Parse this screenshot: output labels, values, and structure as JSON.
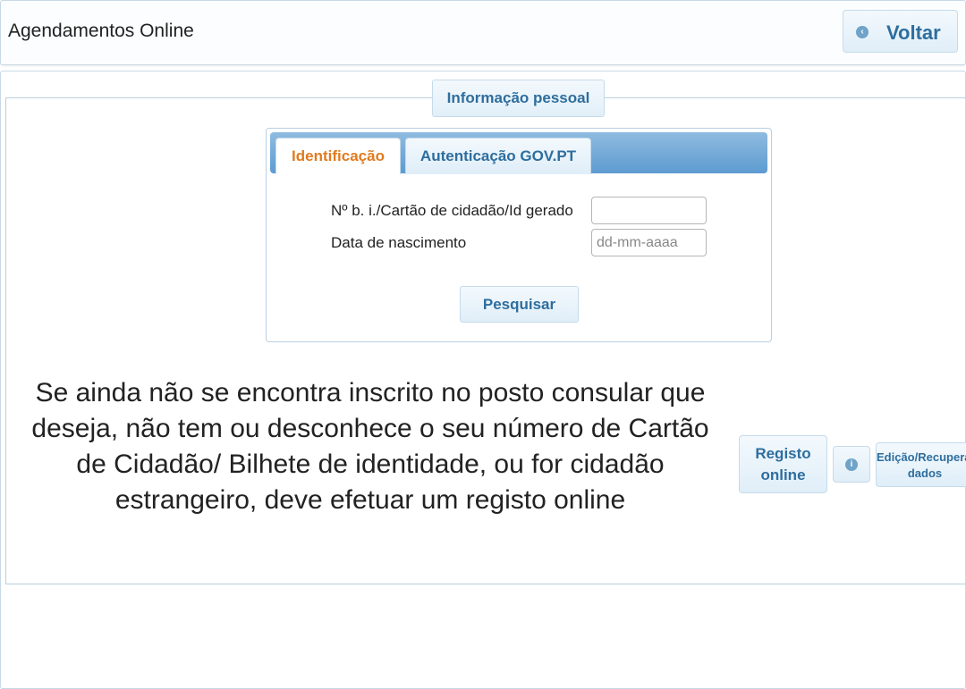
{
  "header": {
    "title": "Agendamentos Online",
    "back_label": "Voltar",
    "back_icon": "arrow-left-circle-icon"
  },
  "section": {
    "legend": "Informação pessoal"
  },
  "tabs": [
    {
      "label": "Identificação",
      "active": true
    },
    {
      "label": "Autenticação GOV.PT",
      "active": false
    }
  ],
  "form": {
    "id_label": "Nº b. i./Cartão de cidadão/Id gerado",
    "id_value": "",
    "birth_label": "Data de nascimento",
    "birth_placeholder": "dd-mm-aaaa",
    "search_label": "Pesquisar"
  },
  "message": "Se ainda não se encontra inscrito no posto consular que deseja, não tem ou desconhece o seu número de Cartão de Cidadão/ Bilhete de identidade, ou for cidadão estrangeiro, deve efetuar um registo online",
  "actions": {
    "register_label": "Registo online",
    "info_icon": "info-icon",
    "edit_label": "Edição/Recuperação dados"
  },
  "colors": {
    "accent": "#2e6e9e",
    "active_tab": "#e07b1f",
    "tab_bar": "#6fa5d4"
  }
}
